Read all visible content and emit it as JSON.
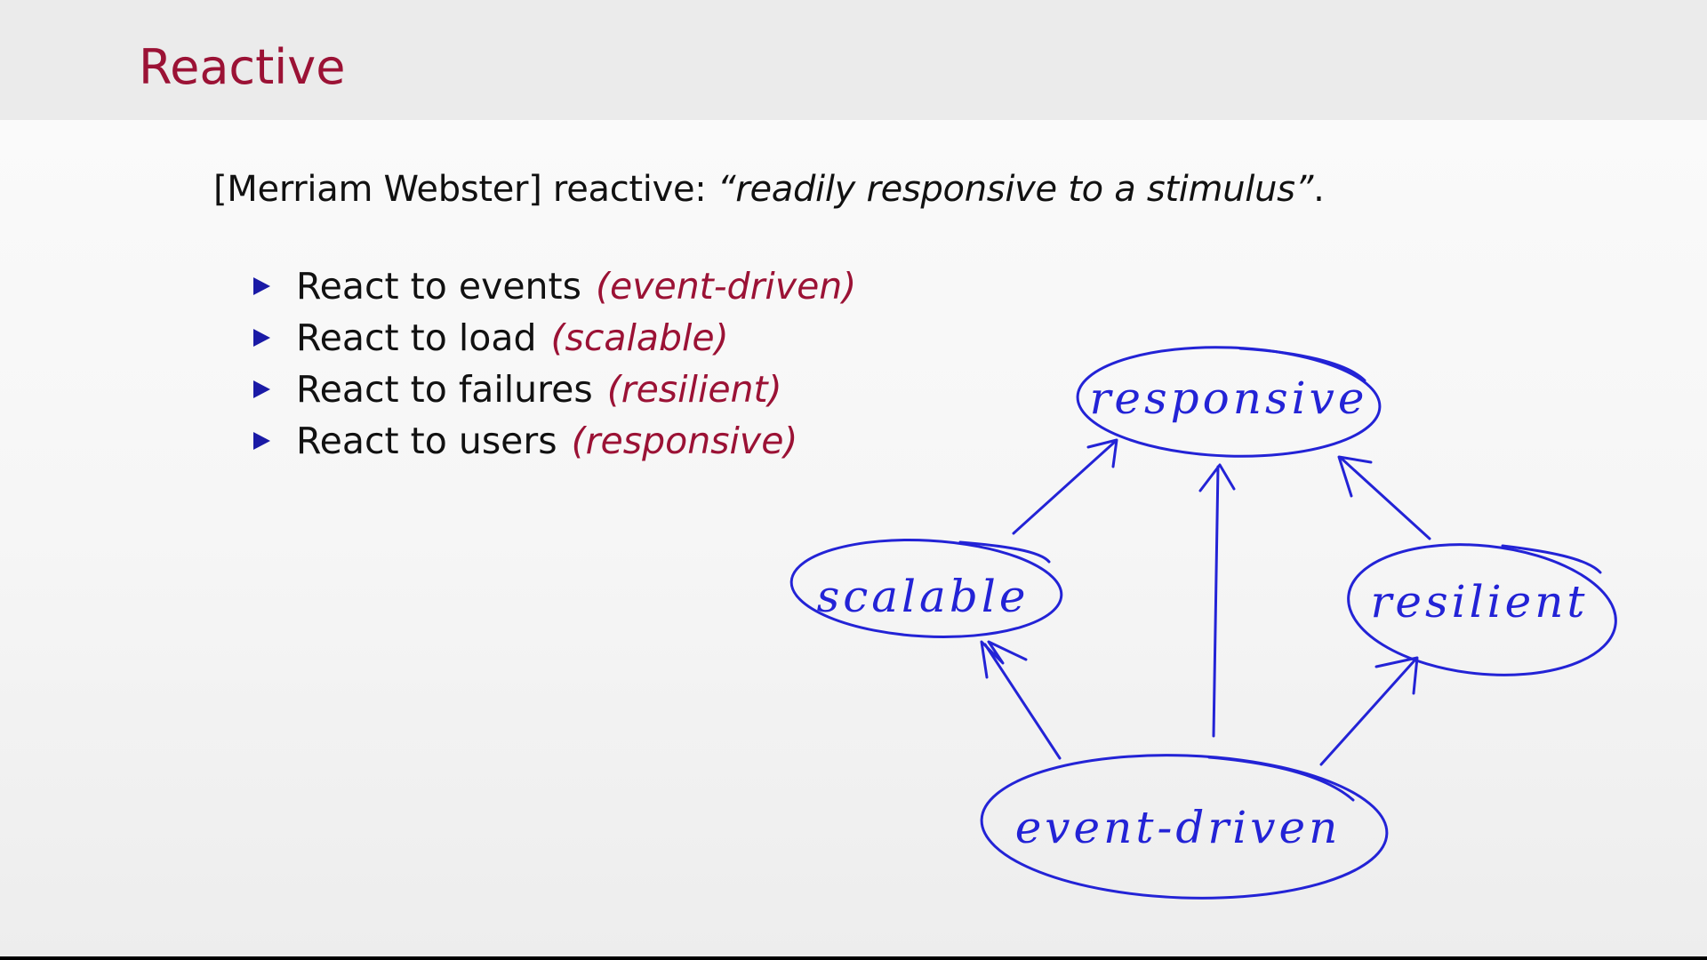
{
  "slide": {
    "title": "Reactive",
    "definition": {
      "prefix": "[Merriam Webster] reactive: ",
      "quote": "“readily responsive to a stimulus”",
      "suffix": "."
    },
    "bullets": [
      {
        "text": "React to events",
        "tag": "(event-driven)"
      },
      {
        "text": "React to load",
        "tag": "(scalable)"
      },
      {
        "text": "React to failures",
        "tag": "(resilient)"
      },
      {
        "text": "React to users",
        "tag": "(responsive)"
      }
    ]
  },
  "diagram": {
    "nodes": {
      "responsive": "responsive",
      "scalable": "scalable",
      "resilient": "resilient",
      "event_driven": "event-driven"
    },
    "edges": [
      {
        "from": "event-driven",
        "to": "scalable"
      },
      {
        "from": "event-driven",
        "to": "responsive"
      },
      {
        "from": "event-driven",
        "to": "resilient"
      },
      {
        "from": "scalable",
        "to": "responsive"
      },
      {
        "from": "resilient",
        "to": "responsive"
      }
    ]
  },
  "colors": {
    "title": "#9b1235",
    "emphasis": "#9b1235",
    "ink": "#2323d6",
    "bullet_marker": "#1a1aa6",
    "header_background": "#ebebeb"
  }
}
